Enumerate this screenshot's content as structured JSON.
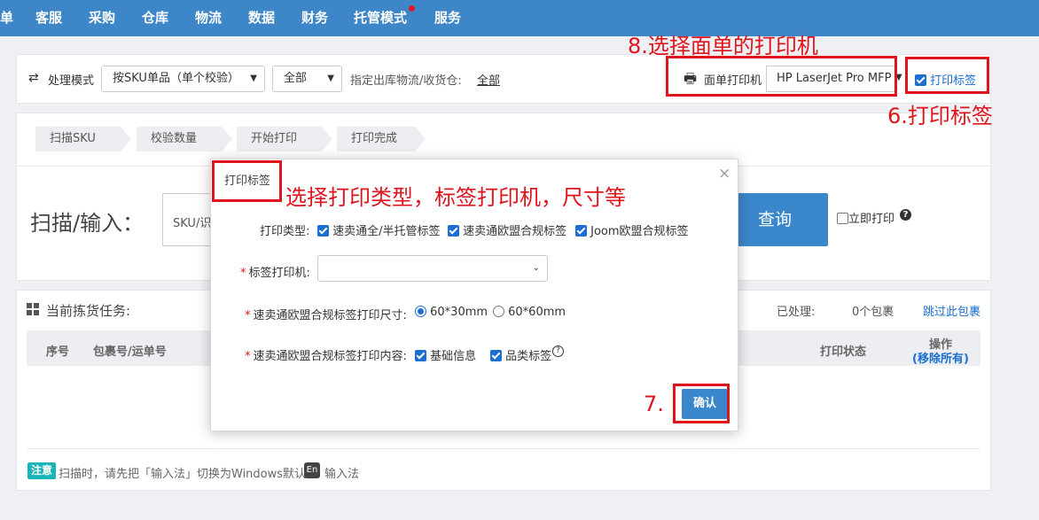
{
  "nav": {
    "items": [
      "单",
      "客服",
      "采购",
      "仓库",
      "物流",
      "数据",
      "财务",
      "托管模式",
      "服务"
    ]
  },
  "toolbar": {
    "mode_label": "处理模式",
    "mode_value": "按SKU单品（单个校验）",
    "filter_value": "全部",
    "carrier_label": "指定出库物流/收货仓:",
    "carrier_link": "全部",
    "printer_label": "面单打印机",
    "printer_value": "HP LaserJet Pro MFP",
    "print_label_checkbox": "打印标签"
  },
  "steps": [
    "扫描SKU",
    "校验数量",
    "开始打印",
    "打印完成"
  ],
  "scan": {
    "title": "扫描/输入：",
    "input_value": "SKU/识",
    "query_button": "查询",
    "instant_print": "立即打印"
  },
  "tasks": {
    "title": "当前拣货任务:",
    "processed_label": "已处理:",
    "processed_value": "0个包裹",
    "skip_link": "跳过此包裹",
    "columns": {
      "index": "序号",
      "package": "包裹号/运单号",
      "print_status": "打印状态",
      "operation": "操作",
      "remove_all": "(移除所有)"
    }
  },
  "notice": {
    "badge": "注意",
    "text_before": "扫描时，请先把「输入法」切换为Windows默认",
    "en_badge": "En",
    "text_after": "输入法"
  },
  "modal": {
    "title": "打印标签",
    "close": "×",
    "print_type_label": "打印类型:",
    "print_types": [
      "速卖通全/半托管标签",
      "速卖通欧盟合规标签",
      "Joom欧盟合规标签"
    ],
    "label_printer_label": "标签打印机:",
    "label_printer_value": "",
    "size_label": "速卖通欧盟合规标签打印尺寸:",
    "sizes": [
      "60*30mm",
      "60*60mm"
    ],
    "selected_size": "60*30mm",
    "content_label": "速卖通欧盟合规标签打印内容:",
    "contents": [
      "基础信息",
      "品类标签"
    ],
    "confirm_button": "确认"
  },
  "annotations": {
    "select_printer": "8.选择面单的打印机",
    "print_label": "6.打印标签",
    "choose_type": "选择打印类型，标签打印机，尺寸等",
    "confirm_step": "7."
  },
  "colors": {
    "nav_bg": "#3d86c8",
    "accent": "#3b87cb",
    "annotation_red": "#e0141c",
    "notice_badge": "#1ab3b8"
  }
}
